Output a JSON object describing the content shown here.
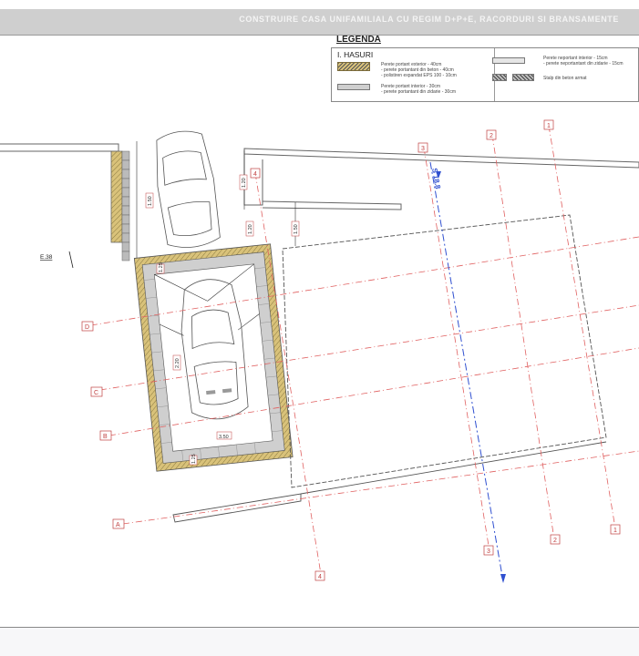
{
  "header": {
    "title": "CONSTRUIRE CASA UNIFAMILIALA CU REGIM D+P+E, RACORDURI SI BRANSAMENTE"
  },
  "legend": {
    "title": "LEGENDA",
    "section": "I. HASURI",
    "exterior_wall": [
      "Perete portant exterior - 40cm",
      "- perete portantant din beton - 40cm",
      "- polistiren expandat EPS 100 - 10cm"
    ],
    "interior_wall": [
      "Perete portant interior - 30cm",
      "- perete portantant din zidarie - 30cm"
    ],
    "nonbearing_wall": [
      "Perete neportant interior - 15cm",
      "- perete neportantant din zidarie - 15cm"
    ],
    "column": "Stalp din beton armat"
  },
  "plan": {
    "axes": {
      "A": "A",
      "B": "B",
      "C": "C",
      "D": "D",
      "n1": "1",
      "n2": "2",
      "n3": "3",
      "n4": "4"
    },
    "section_mark": "S 18.8",
    "elevation_mark": "E.38",
    "dims": {
      "d1": "1.50",
      "d2": "1.20",
      "d3": "1.50",
      "d4": "1.20",
      "d5": "2.20",
      "d6": "3.50",
      "d7": "1.25",
      "d8": "1.25"
    }
  },
  "colors": {
    "axis": "#e06060",
    "section": "#3050d0",
    "wall_fill": "#d9c27a",
    "wall_dark": "#666666"
  }
}
